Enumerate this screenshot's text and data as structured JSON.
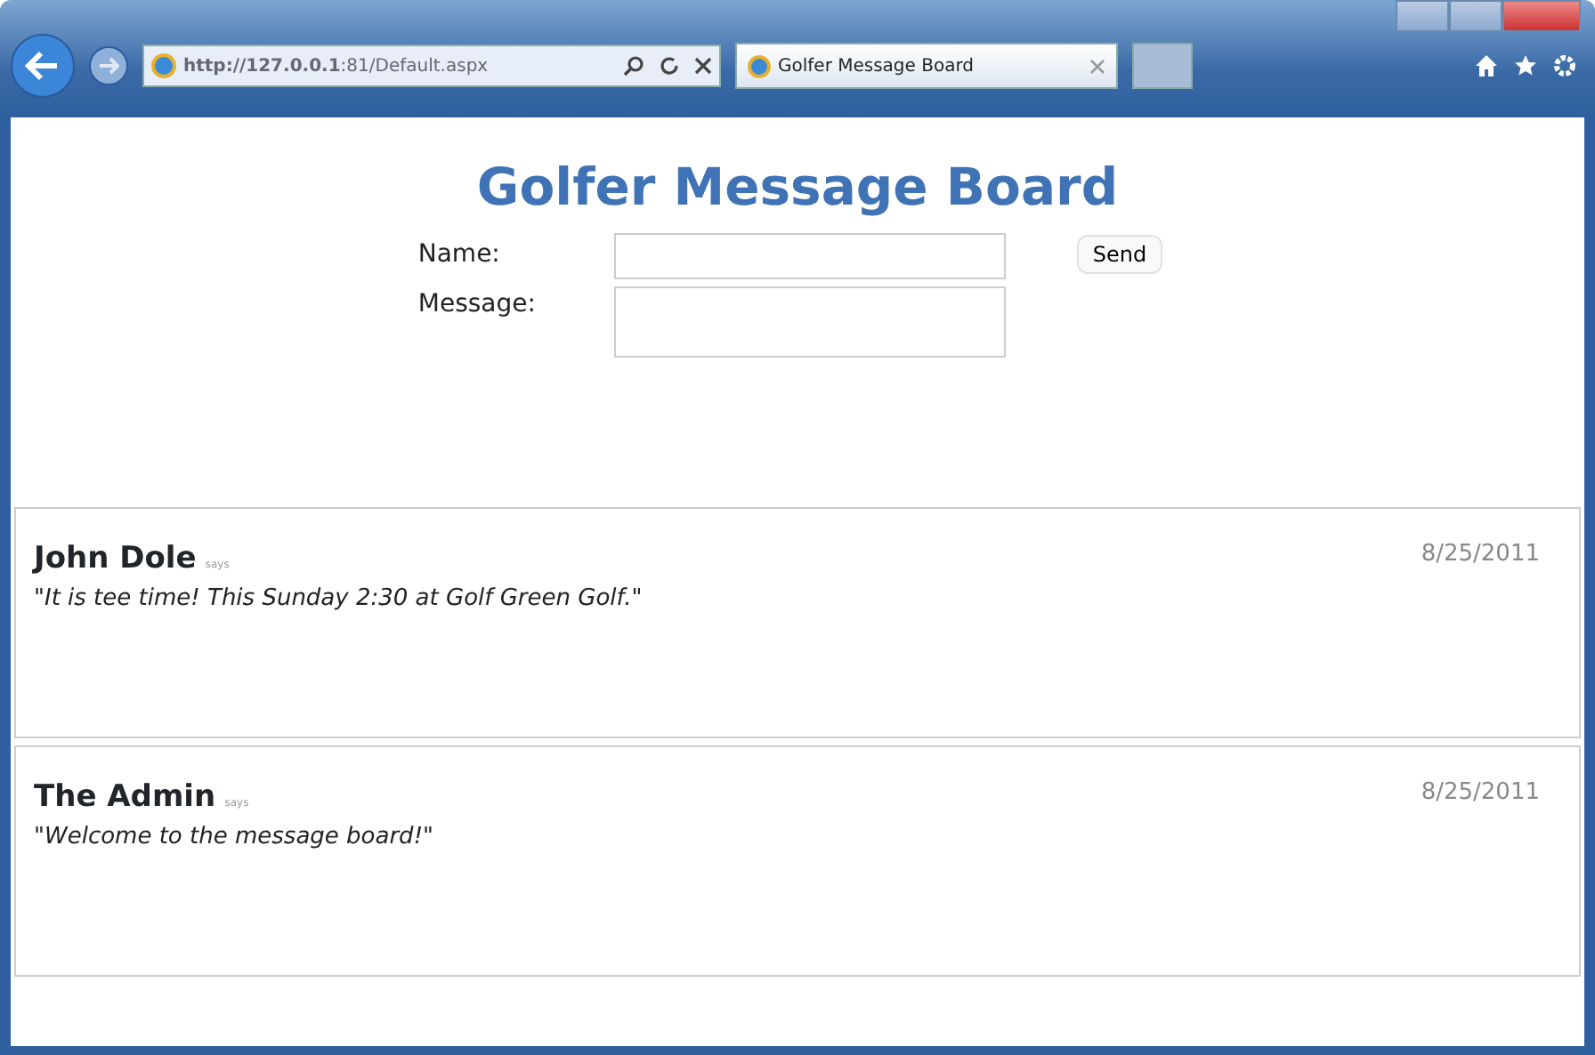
{
  "browser": {
    "url_host": "http://127.0.0.1",
    "url_rest": ":81/Default.aspx",
    "tabs": [
      {
        "label": "Golfer Message Board",
        "selected": true
      }
    ]
  },
  "page": {
    "title": "Golfer Message Board",
    "form": {
      "name_label": "Name:",
      "message_label": "Message:",
      "send": "Send"
    },
    "messages": [
      {
        "author": "John Dole",
        "says": "says",
        "text": "\"It is tee time! This Sunday 2:30 at Golf Green Golf.\"",
        "date": "8/25/2011"
      },
      {
        "author": "The Admin",
        "says": "says",
        "text": "\"Welcome to the message board!\"",
        "date": "8/25/2011"
      }
    ]
  }
}
